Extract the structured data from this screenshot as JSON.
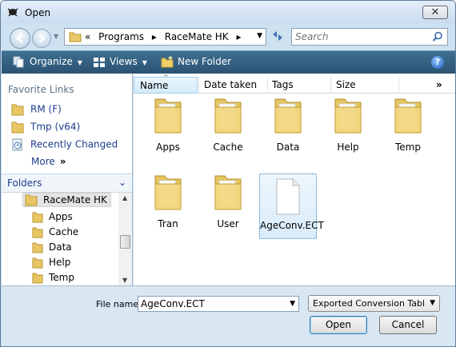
{
  "window": {
    "title": "Open",
    "close_label": "✕"
  },
  "nav": {
    "breadcrumbs": [
      "«",
      "Programs",
      "▸",
      "RaceMate HK",
      "▸"
    ],
    "search_placeholder": "Search"
  },
  "toolbar": {
    "organize": "Organize",
    "views": "Views",
    "new_folder": "New Folder",
    "help": "?"
  },
  "favorites": {
    "heading": "Favorite Links",
    "items": [
      "RM (F)",
      "Tmp (v64)",
      "Recently Changed"
    ],
    "more": "More",
    "more_glyph": "»"
  },
  "folders": {
    "label": "Folders",
    "tree": [
      "RaceMate HK",
      "Apps",
      "Cache",
      "Data",
      "Help",
      "Temp"
    ]
  },
  "columns": [
    "Name",
    "Date taken",
    "Tags",
    "Size"
  ],
  "files": [
    {
      "name": "Apps",
      "type": "folder"
    },
    {
      "name": "Cache",
      "type": "folder"
    },
    {
      "name": "Data",
      "type": "folder"
    },
    {
      "name": "Help",
      "type": "folder"
    },
    {
      "name": "Temp",
      "type": "folder"
    },
    {
      "name": "Tran",
      "type": "folder"
    },
    {
      "name": "User",
      "type": "folder"
    },
    {
      "name": "AgeConv.ECT",
      "type": "file",
      "selected": true
    }
  ],
  "bottom": {
    "file_name_label": "File name:",
    "file_name_value": "AgeConv.ECT",
    "file_type": "Exported Conversion Table (*",
    "open": "Open",
    "cancel": "Cancel"
  }
}
